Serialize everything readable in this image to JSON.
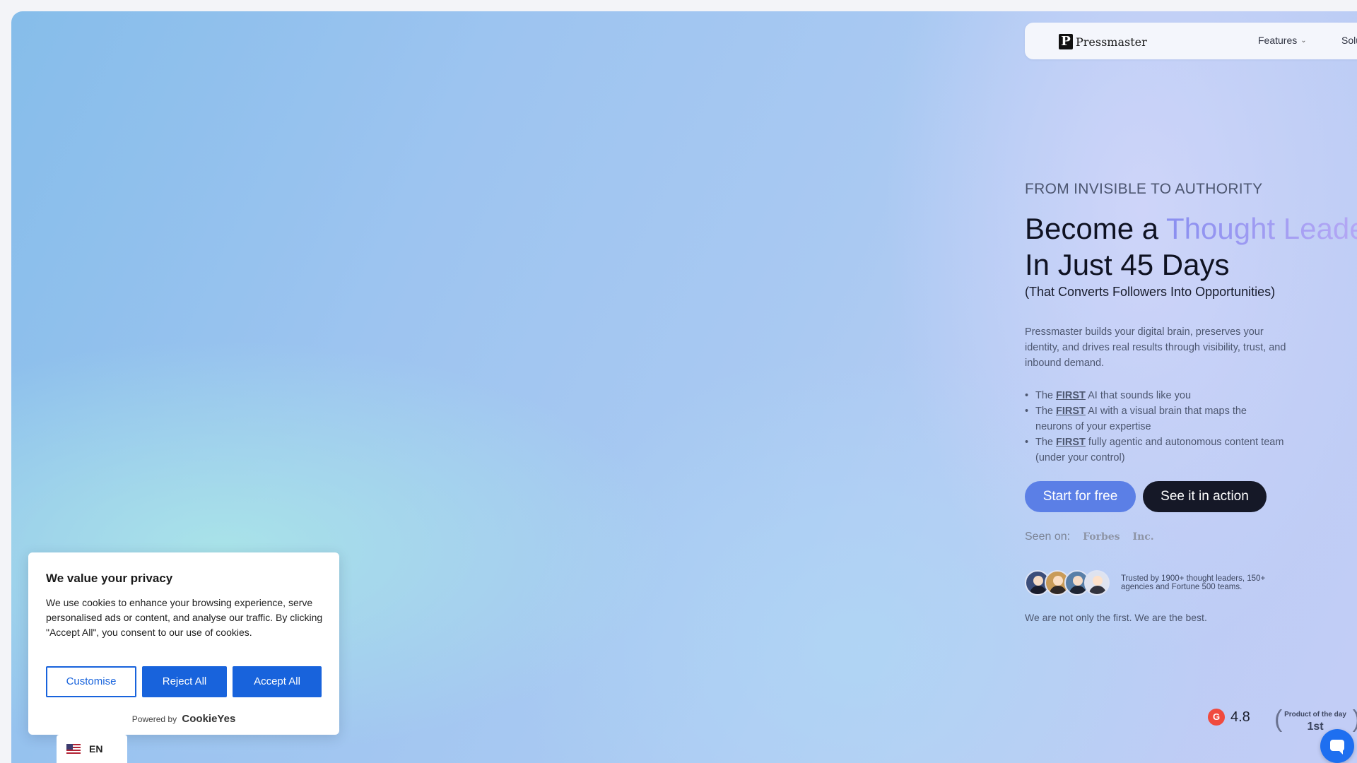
{
  "nav": {
    "logo_mark": "P",
    "logo_text": "Pressmaster",
    "features": "Features",
    "solutions": "Soluti"
  },
  "hero": {
    "eyebrow": "FROM INVISIBLE TO AUTHORITY",
    "title_prefix": "Become a ",
    "title_highlight": "Thought Leade",
    "title_line2": "In Just 45 Days",
    "subhead": "(That Converts Followers Into Opportunities)",
    "description": "Pressmaster builds your digital brain, preserves your identity, and drives real results through visibility, trust, and inbound demand.",
    "bullets": [
      {
        "pre": "The ",
        "strong": "FIRST",
        "post": " AI that sounds like you"
      },
      {
        "pre": "The ",
        "strong": "FIRST",
        "post": " AI with a visual brain that maps the neurons of your expertise"
      },
      {
        "pre": "The ",
        "strong": "FIRST",
        "post": " fully agentic and autonomous content team (under your control)"
      }
    ],
    "cta_primary": "Start for free",
    "cta_secondary": "See it in action",
    "seen_on": "Seen on:",
    "seen_logos": [
      "Forbes",
      "Inc."
    ],
    "trusted": "Trusted by 1900+ thought leaders, 150+ agencies and Fortune 500 teams.",
    "not_only": "We are not only the first. We are the best."
  },
  "ratings": {
    "g2_icon": "G",
    "g2_score": "4.8",
    "pod_label": "Product of the day",
    "pod_rank": "1st"
  },
  "cookie": {
    "title": "We value your privacy",
    "body": "We use cookies to enhance your browsing experience, serve personalised ads or content, and analyse our traffic. By clicking \"Accept All\", you consent to our use of cookies.",
    "customise": "Customise",
    "reject": "Reject All",
    "accept": "Accept All",
    "powered_by": "Powered by",
    "powered_brand": "CookieYes"
  },
  "lang": {
    "code": "EN"
  },
  "colors": {
    "primary_button": "#5b7fe6",
    "dark_button": "#151827",
    "cookie_accent": "#1863dc",
    "chat": "#1e6ff0"
  },
  "icons": [
    "chevron-down-icon",
    "g2-icon",
    "laurel-icon",
    "chat-icon",
    "us-flag-icon"
  ]
}
